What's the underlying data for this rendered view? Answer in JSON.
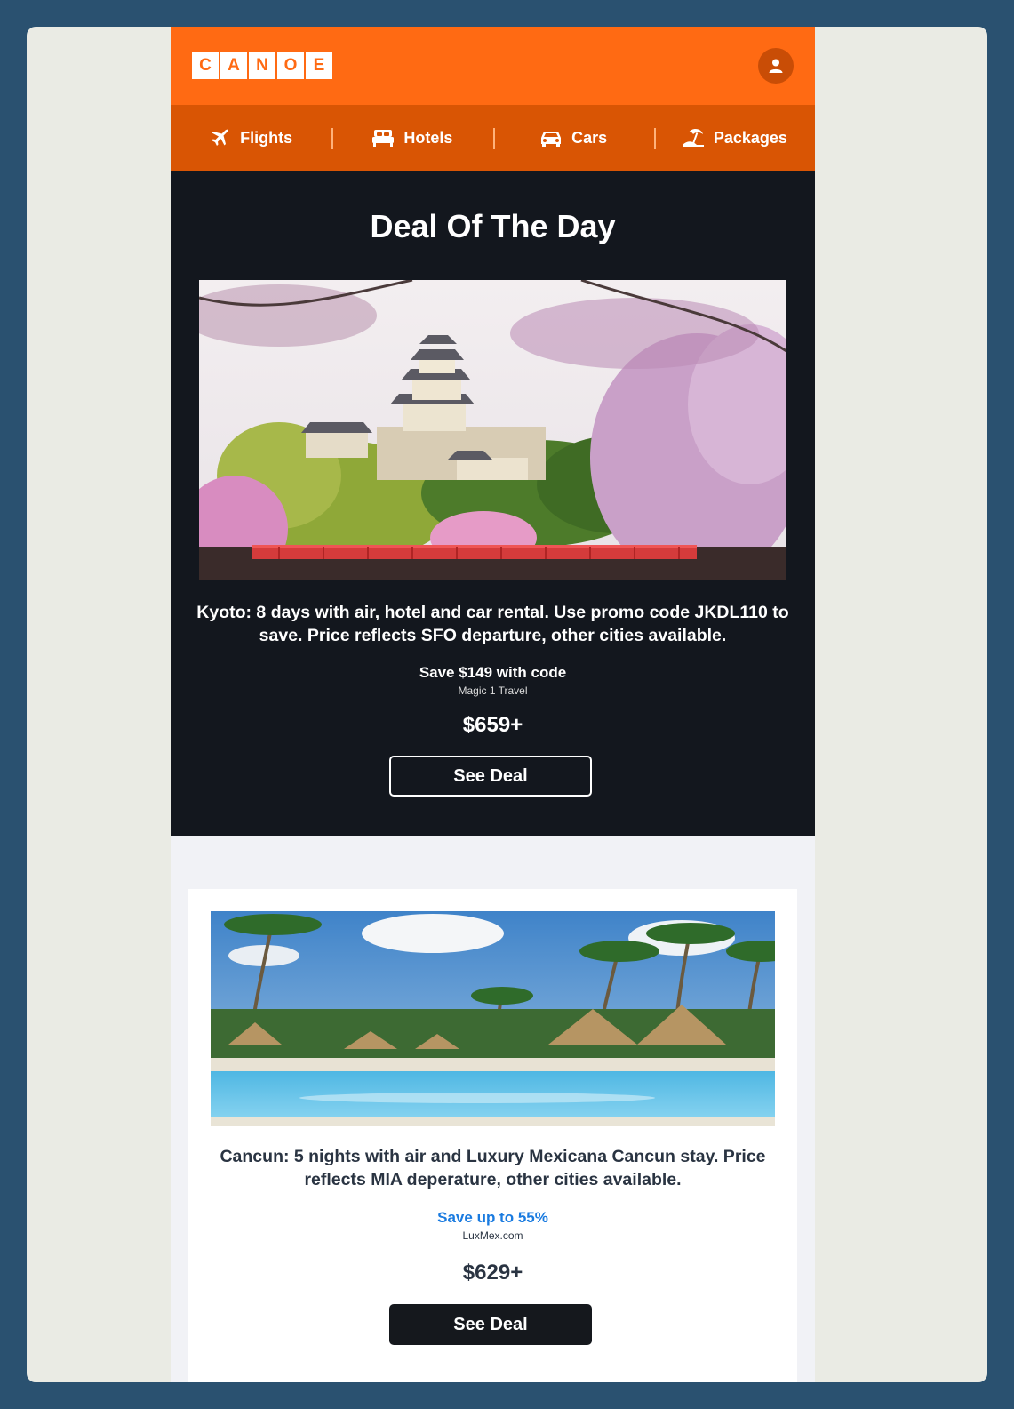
{
  "header": {
    "logo_letters": [
      "C",
      "A",
      "N",
      "O",
      "E"
    ],
    "brand_color": "#ff6a13",
    "nav_color": "#d95504",
    "account_icon": "user-icon"
  },
  "nav": {
    "items": [
      {
        "label": "Flights",
        "icon": "plane-icon"
      },
      {
        "label": "Hotels",
        "icon": "bed-icon"
      },
      {
        "label": "Cars",
        "icon": "car-icon"
      },
      {
        "label": "Packages",
        "icon": "beach-umbrella-icon"
      }
    ]
  },
  "hero": {
    "title": "Deal Of The Day",
    "description": "Kyoto: 8 days with air, hotel and car rental. Use promo code JKDL110 to save. Price reflects SFO departure, other cities available.",
    "save_text": "Save $149 with code",
    "vendor": "Magic 1 Travel",
    "price": "$659+",
    "button_label": "See Deal"
  },
  "deal2": {
    "description": "Cancun: 5 nights with air and Luxury Mexicana Cancun stay. Price reflects MIA deperature, other cities available.",
    "save_text": "Save up to 55%",
    "save_color": "#1a7be0",
    "vendor": "LuxMex.com",
    "price": "$629+",
    "button_label": "See Deal"
  }
}
